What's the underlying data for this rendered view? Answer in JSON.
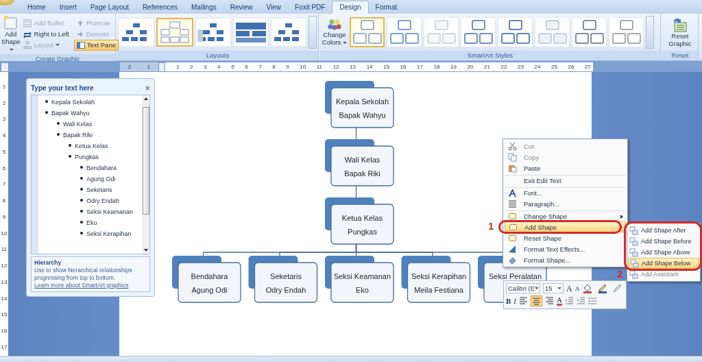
{
  "tabs": [
    {
      "label": "Home",
      "selected": false
    },
    {
      "label": "Insert",
      "selected": false
    },
    {
      "label": "Page Layout",
      "selected": false
    },
    {
      "label": "References",
      "selected": false
    },
    {
      "label": "Mailings",
      "selected": false
    },
    {
      "label": "Review",
      "selected": false
    },
    {
      "label": "View",
      "selected": false
    },
    {
      "label": "Foxit PDF",
      "selected": false
    },
    {
      "label": "Design",
      "selected": true
    },
    {
      "label": "Format",
      "selected": false
    }
  ],
  "create_graphic": {
    "label": "Create Graphic",
    "add_shape": "Add Shape",
    "small_buttons": [
      {
        "label": "Add Bullet",
        "kind": "bullet",
        "disabled": true,
        "active": false,
        "dropdown": false
      },
      {
        "label": "Right to Left",
        "kind": "rtl",
        "disabled": false,
        "active": false,
        "dropdown": false
      },
      {
        "label": "Layout",
        "kind": "layout",
        "disabled": true,
        "active": false,
        "dropdown": true
      },
      {
        "label": "Promote",
        "kind": "promote",
        "disabled": true,
        "active": false,
        "dropdown": false
      },
      {
        "label": "Demote",
        "kind": "demote",
        "disabled": true,
        "active": false,
        "dropdown": false
      },
      {
        "label": "Text Pane",
        "kind": "pane",
        "disabled": false,
        "active": true,
        "dropdown": false
      }
    ]
  },
  "layouts": {
    "label": "Layouts",
    "items": [
      {
        "selected": false
      },
      {
        "selected": true
      },
      {
        "selected": false
      },
      {
        "selected": false
      },
      {
        "selected": false
      }
    ]
  },
  "smartart_styles": {
    "label": "SmartArt Styles",
    "change_colors": "Change Colors",
    "items": [
      {
        "selected": true
      },
      {
        "selected": false
      },
      {
        "selected": false
      },
      {
        "selected": false
      },
      {
        "selected": false
      },
      {
        "selected": false
      },
      {
        "selected": false
      },
      {
        "selected": false
      }
    ]
  },
  "reset": {
    "label": "Reset",
    "button": "Reset Graphic"
  },
  "horizontal_ruler": {
    "before": [
      "2",
      "1"
    ],
    "after": [
      "1",
      "2",
      "3",
      "4",
      "5",
      "6",
      "7",
      "8",
      "9",
      "10",
      "11",
      "12",
      "13",
      "14",
      "15",
      "16",
      "17",
      "18",
      "19",
      "20",
      "21",
      "22",
      "23",
      "24",
      "25",
      "26",
      "27"
    ]
  },
  "vertical_ruler": [
    "1",
    "2",
    "3",
    "4",
    "5",
    "6",
    "7",
    "8",
    "9",
    "10",
    "11",
    "12",
    "13",
    "14",
    "15",
    "16",
    "17"
  ],
  "text_pane": {
    "title": "Type your text here",
    "close": "×",
    "items": [
      {
        "text": "Kepala Sekolah"
      },
      {
        "text": "Bapak Wahyu",
        "children": [
          {
            "text": "Wali Kelas"
          },
          {
            "text": "Bapak Riki",
            "children": [
              {
                "text": "Ketua Kelas"
              },
              {
                "text": "Pungkas",
                "children": [
                  {
                    "text": "Bendahara"
                  },
                  {
                    "text": "Agung Odi"
                  },
                  {
                    "text": "Seketaris"
                  },
                  {
                    "text": "Odry Endah"
                  },
                  {
                    "text": "Seksi Keamanan"
                  },
                  {
                    "text": "Eko"
                  },
                  {
                    "text": "Seksi Kerapihan"
                  }
                ]
              }
            ]
          }
        ]
      }
    ],
    "info_title": "Hierarchy",
    "info_text": "Use to show hierarchical relationships progressing from top to bottom.",
    "link": "Learn more about SmartArt graphics"
  },
  "diagram": {
    "lines": [
      "Kepala Sekolah",
      "Bapak Wahyu"
    ],
    "children": [
      {
        "lines": [
          "Wali Kelas",
          "Bapak Riki"
        ],
        "children": [
          {
            "lines": [
              "Ketua Kelas",
              "Pungkas"
            ],
            "children": [
              {
                "lines": [
                  "Bendahara",
                  "Agung Odi"
                ]
              },
              {
                "lines": [
                  "Seketaris",
                  "Odry Endah"
                ]
              },
              {
                "lines": [
                  "Seksi Keamanan",
                  "Eko"
                ]
              },
              {
                "lines": [
                  "Seksi Kerapihan",
                  "Meila Festiana"
                ]
              },
              {
                "lines": [
                  "Seksi Peralatan"
                ]
              }
            ]
          }
        ]
      }
    ]
  },
  "context_menu": [
    {
      "label": "Cut",
      "kind": "cut",
      "disabled": true,
      "highlighted": false,
      "submenu": false,
      "separator_before": false
    },
    {
      "label": "Copy",
      "kind": "copy",
      "disabled": true,
      "highlighted": false,
      "submenu": false,
      "separator_before": false
    },
    {
      "label": "Paste",
      "kind": "paste",
      "disabled": false,
      "highlighted": false,
      "submenu": false,
      "separator_before": false
    },
    {
      "label": "Exit Edit Text",
      "kind": "none",
      "disabled": false,
      "highlighted": false,
      "submenu": false,
      "separator_before": true
    },
    {
      "label": "Font...",
      "kind": "font",
      "disabled": false,
      "highlighted": false,
      "submenu": false,
      "separator_before": true
    },
    {
      "label": "Paragraph...",
      "kind": "paragraph",
      "disabled": false,
      "highlighted": false,
      "submenu": false,
      "separator_before": false
    },
    {
      "label": "Change Shape",
      "kind": "shape",
      "disabled": false,
      "highlighted": false,
      "submenu": true,
      "separator_before": true
    },
    {
      "label": "Add Shape",
      "kind": "addshape",
      "disabled": false,
      "highlighted": true,
      "submenu": true,
      "separator_before": false
    },
    {
      "label": "Reset Shape",
      "kind": "reset",
      "disabled": false,
      "highlighted": false,
      "submenu": false,
      "separator_before": false
    },
    {
      "label": "Format Text Effects...",
      "kind": "effects",
      "disabled": false,
      "highlighted": false,
      "submenu": false,
      "separator_before": false
    },
    {
      "label": "Format Shape...",
      "kind": "format",
      "disabled": false,
      "highlighted": false,
      "submenu": false,
      "separator_before": false
    }
  ],
  "submenu": [
    {
      "label": "Add Shape After",
      "highlighted": false,
      "disabled": false
    },
    {
      "label": "Add Shape Before",
      "highlighted": false,
      "disabled": false
    },
    {
      "label": "Add Shape Above",
      "highlighted": false,
      "disabled": false
    },
    {
      "label": "Add Shape Below",
      "highlighted": true,
      "disabled": false
    },
    {
      "label": "Add Assistant",
      "highlighted": false,
      "disabled": true
    }
  ],
  "mini_toolbar": {
    "font": "Calibri (E",
    "size": "15",
    "grow": "A",
    "shrink": "A",
    "bold": "B",
    "italic": "I",
    "font_color": "A"
  },
  "annotations": [
    {
      "label": "1"
    },
    {
      "label": "2"
    }
  ]
}
